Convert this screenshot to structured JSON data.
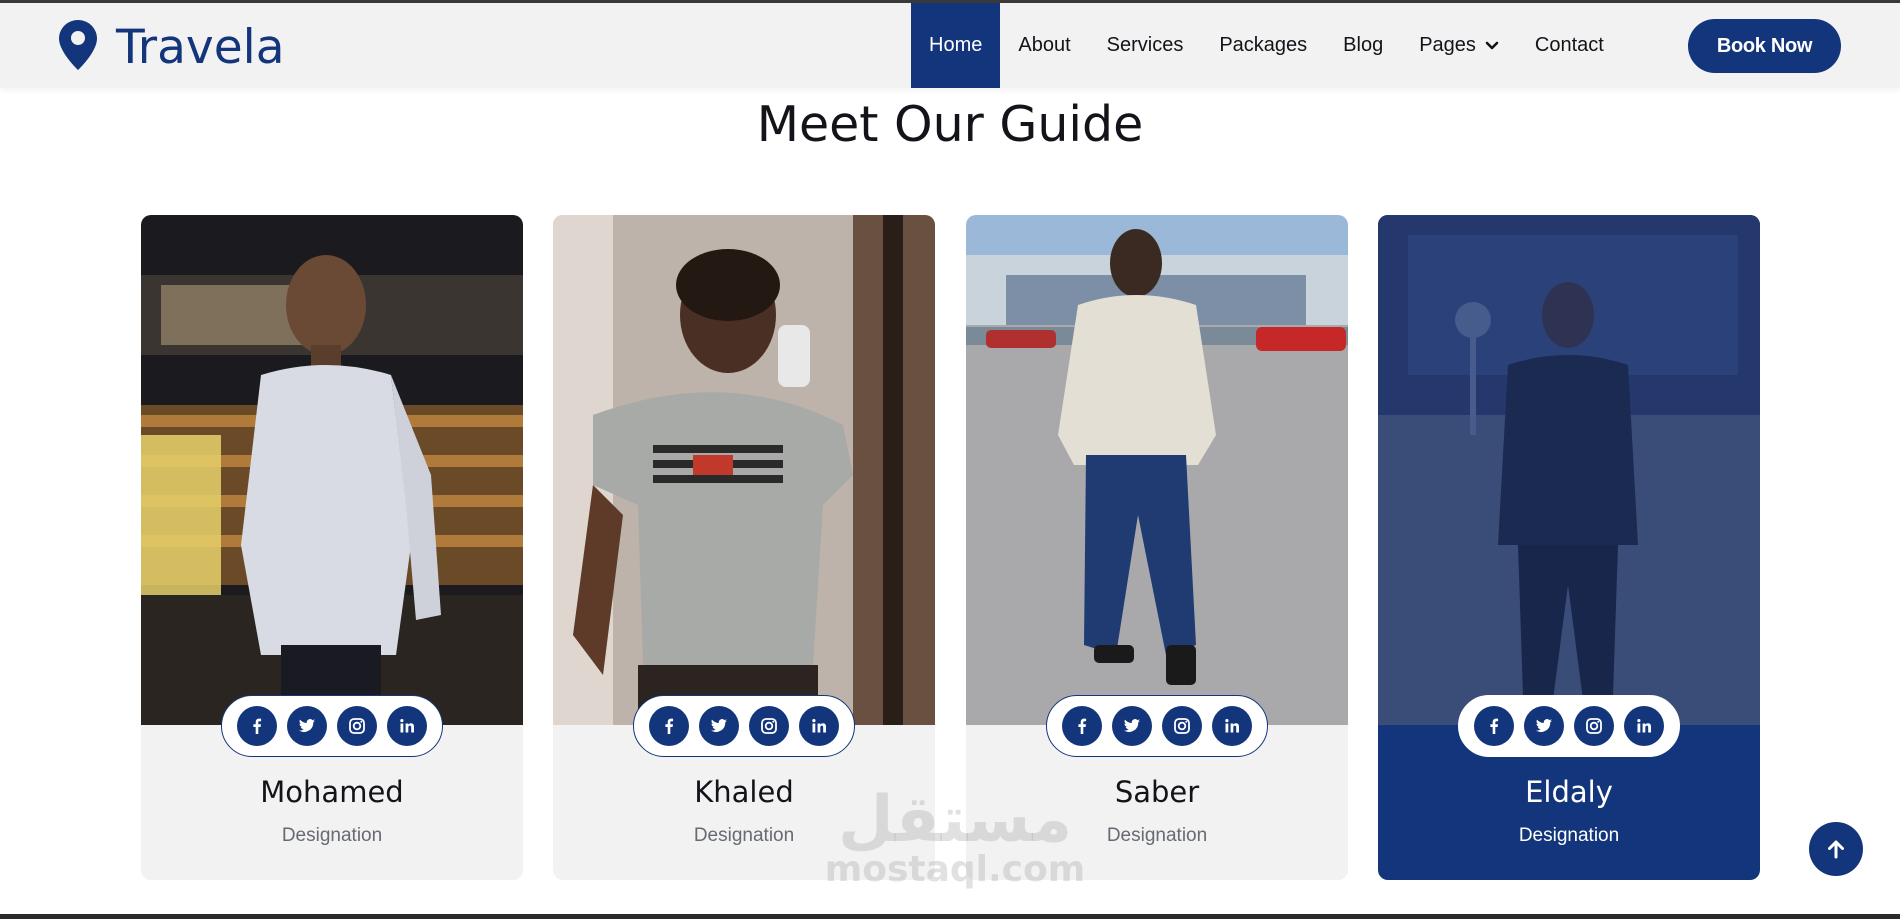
{
  "brand": {
    "name": "Travela",
    "icon": "map-marker-icon"
  },
  "nav": {
    "items": [
      {
        "label": "Home",
        "active": true
      },
      {
        "label": "About"
      },
      {
        "label": "Services"
      },
      {
        "label": "Packages"
      },
      {
        "label": "Blog"
      },
      {
        "label": "Pages",
        "has_dropdown": true
      },
      {
        "label": "Contact"
      }
    ],
    "cta_label": "Book Now"
  },
  "section": {
    "title": "Meet Our Guide"
  },
  "guides": [
    {
      "name": "Mohamed",
      "designation": "Designation"
    },
    {
      "name": "Khaled",
      "designation": "Designation"
    },
    {
      "name": "Saber",
      "designation": "Designation"
    },
    {
      "name": "Eldaly",
      "designation": "Designation",
      "highlighted": true
    }
  ],
  "social_icons": [
    "facebook-icon",
    "twitter-icon",
    "instagram-icon",
    "linkedin-icon"
  ],
  "watermark": {
    "arabic": "مستقل",
    "latin": "mostaql.com"
  },
  "colors": {
    "primary": "#13357b",
    "nav_bg": "#f2f2f2",
    "card_bg": "#f2f2f2",
    "text": "#13141a",
    "muted": "#666a72"
  }
}
